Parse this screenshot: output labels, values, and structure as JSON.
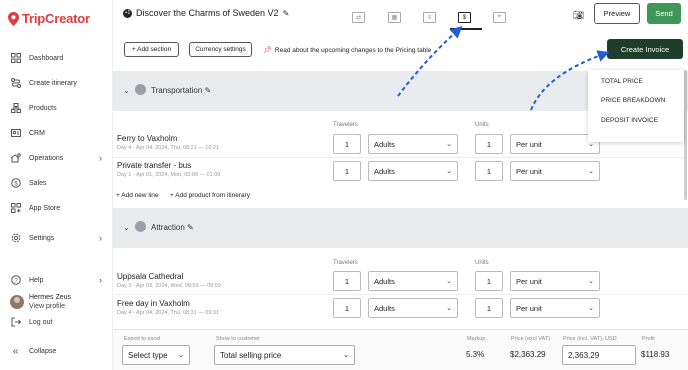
{
  "app": {
    "logo_text": "TripCreator"
  },
  "sidebar": {
    "items": [
      {
        "label": "Dashboard",
        "icon": "grid-icon"
      },
      {
        "label": "Create itinerary",
        "icon": "route-icon"
      },
      {
        "label": "Products",
        "icon": "org-icon"
      },
      {
        "label": "CRM",
        "icon": "contact-card-icon"
      },
      {
        "label": "Operations",
        "icon": "operations-icon"
      },
      {
        "label": "Sales",
        "icon": "dollar-icon"
      },
      {
        "label": "App Store",
        "icon": "apps-icon"
      },
      {
        "label": "Settings",
        "icon": "gear-icon"
      }
    ],
    "help": "Help",
    "user_name": "Hermes Zeus",
    "view_profile": "View profile",
    "log_out": "Log out",
    "collapse": "Collapse"
  },
  "header": {
    "badge": "+1",
    "trip_title": "Discover the Charms of Sweden V2",
    "preview": "Preview",
    "send": "Send"
  },
  "toolbar": {
    "add_section": "+ Add section",
    "currency_settings": "Currency settings",
    "notice": "Read about the upcoming changes to the Pricing table",
    "create_invoice": "Create Invoice"
  },
  "invoice_menu": [
    "TOTAL PRICE",
    "PRICE BREAKDOWN",
    "DEPOSIT INVOICE"
  ],
  "columns": {
    "travelers": "Travelers",
    "units": "Units"
  },
  "sections": [
    {
      "title": "Transportation",
      "rows": [
        {
          "name": "Ferry to Vaxholm",
          "sub": "Day 4 - Apr 04, 2024, Thu, 08:21 — 10:21",
          "travelers": "1",
          "traveler_type": "Adults",
          "units": "1",
          "unit_type": "Per unit"
        },
        {
          "name": "Private transfer - bus",
          "sub": "Day 1 - Apr 01, 2024, Mon, 00:00 — 01:00",
          "travelers": "1",
          "traveler_type": "Adults",
          "units": "1",
          "unit_type": "Per unit"
        }
      ],
      "add_line": "+ Add new line",
      "add_product": "+ Add product from itinerary"
    },
    {
      "title": "Attraction",
      "rows": [
        {
          "name": "Uppsala Cathedral",
          "sub": "Day 3 - Apr 03, 2024, Wed, 08:59 — 09:59",
          "travelers": "1",
          "traveler_type": "Adults",
          "units": "1",
          "unit_type": "Per unit"
        },
        {
          "name": "Free day in Vaxholm",
          "sub": "Day 4 - Apr 04, 2024, Thu, 08:31 — 09:31",
          "travelers": "1",
          "traveler_type": "Adults",
          "units": "1",
          "unit_type": "Per unit"
        }
      ]
    }
  ],
  "footer": {
    "export_label": "Export to excel",
    "export_value": "Select type",
    "show_label": "Show to customer",
    "show_value": "Total selling price",
    "markup_label": "Markup",
    "markup_value": "5.3%",
    "price_excl_label": "Price (excl VAT)",
    "price_excl_value": "$2,363.29",
    "price_incl_label": "Price (incl. VAT), USD",
    "price_incl_value": "2,363.29",
    "profit_label": "Profit",
    "profit_value": "$118.93"
  },
  "colors": {
    "brand": "#e23d3d",
    "send": "#3f9659",
    "invoice": "#1e3d2a",
    "arrow": "#1f5fd6"
  }
}
